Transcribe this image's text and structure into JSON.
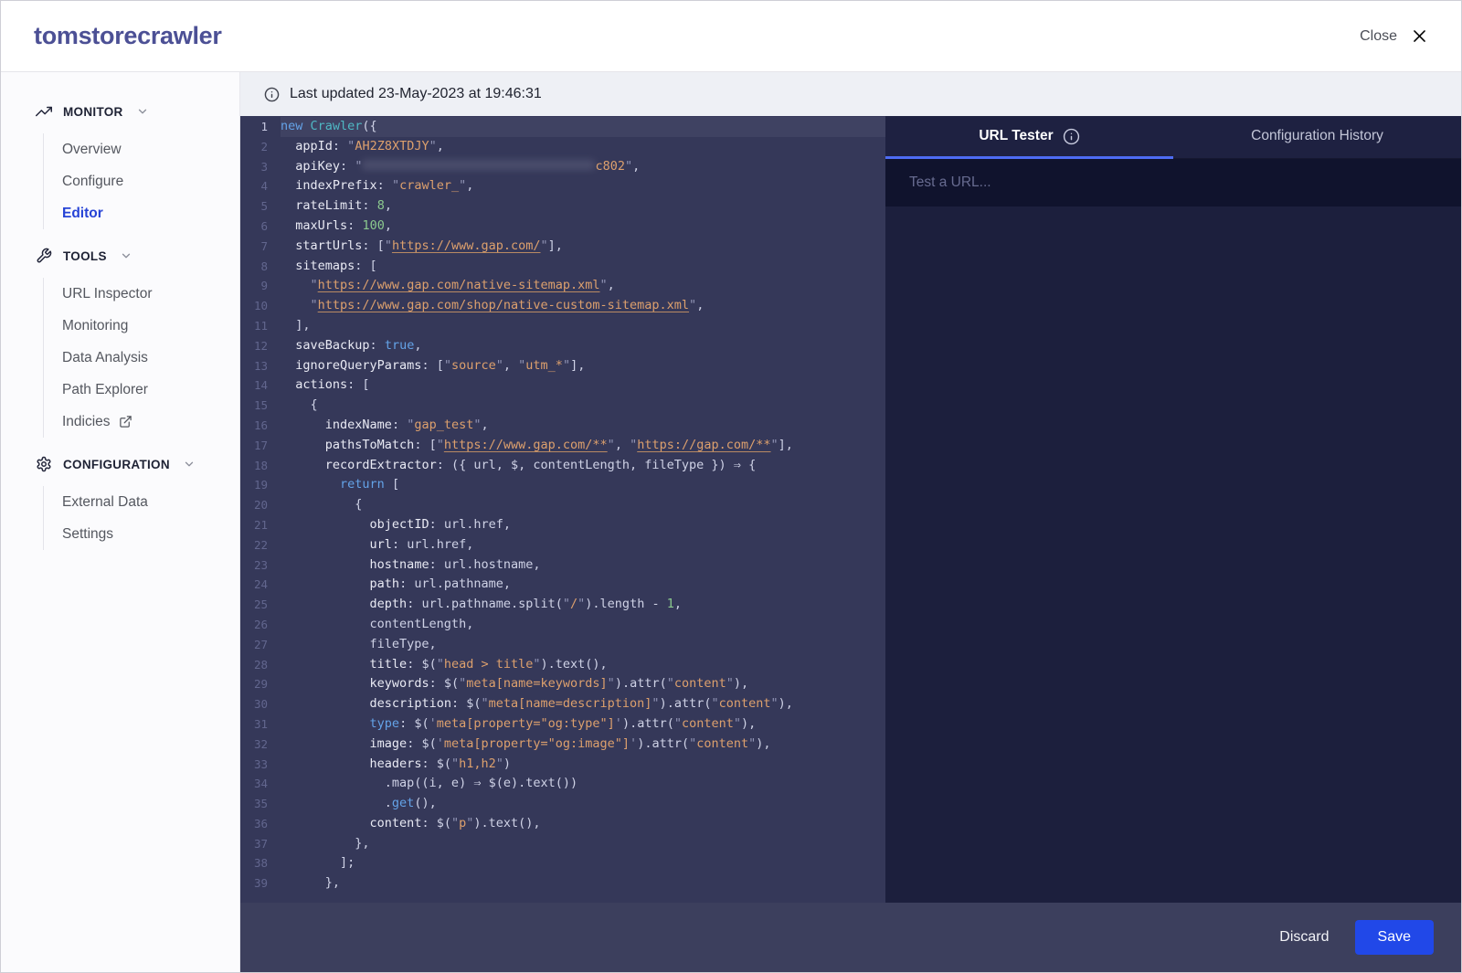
{
  "header": {
    "title": "tomstorecrawler",
    "close_label": "Close"
  },
  "sidebar": {
    "sections": [
      {
        "label": "MONITOR",
        "icon": "trending-up",
        "items": [
          {
            "label": "Overview"
          },
          {
            "label": "Configure"
          },
          {
            "label": "Editor",
            "active": true
          }
        ]
      },
      {
        "label": "TOOLS",
        "icon": "wrench",
        "items": [
          {
            "label": "URL Inspector"
          },
          {
            "label": "Monitoring"
          },
          {
            "label": "Data Analysis"
          },
          {
            "label": "Path Explorer"
          },
          {
            "label": "Indicies",
            "external": true
          }
        ]
      },
      {
        "label": "CONFIGURATION",
        "icon": "gear",
        "items": [
          {
            "label": "External Data"
          },
          {
            "label": "Settings"
          }
        ]
      }
    ]
  },
  "status_bar": {
    "text": "Last updated 23-May-2023 at 19:46:31"
  },
  "editor": {
    "lines": [
      {
        "hl": true,
        "t": [
          [
            "k",
            "new "
          ],
          [
            "t",
            "Crawler"
          ],
          [
            "p",
            "({"
          ]
        ]
      },
      {
        "t": [
          [
            "p",
            "  "
          ],
          [
            "key",
            "appId"
          ],
          [
            "p",
            ": "
          ],
          [
            "q",
            "\""
          ],
          [
            "s",
            "AH2Z8XTDJY"
          ],
          [
            "q",
            "\""
          ],
          [
            "p",
            ","
          ]
        ]
      },
      {
        "t": [
          [
            "p",
            "  "
          ],
          [
            "key",
            "apiKey"
          ],
          [
            "p",
            ": "
          ],
          [
            "q",
            "\""
          ],
          [
            "blur",
            ""
          ],
          [
            "s",
            "c802"
          ],
          [
            "q",
            "\""
          ],
          [
            "p",
            ","
          ]
        ]
      },
      {
        "t": [
          [
            "p",
            "  "
          ],
          [
            "key",
            "indexPrefix"
          ],
          [
            "p",
            ": "
          ],
          [
            "q",
            "\""
          ],
          [
            "s",
            "crawler_"
          ],
          [
            "q",
            "\""
          ],
          [
            "p",
            ","
          ]
        ]
      },
      {
        "t": [
          [
            "p",
            "  "
          ],
          [
            "key",
            "rateLimit"
          ],
          [
            "p",
            ": "
          ],
          [
            "n",
            "8"
          ],
          [
            "p",
            ","
          ]
        ]
      },
      {
        "t": [
          [
            "p",
            "  "
          ],
          [
            "key",
            "maxUrls"
          ],
          [
            "p",
            ": "
          ],
          [
            "n",
            "100"
          ],
          [
            "p",
            ","
          ]
        ]
      },
      {
        "t": [
          [
            "p",
            "  "
          ],
          [
            "key",
            "startUrls"
          ],
          [
            "p",
            ": ["
          ],
          [
            "q",
            "\""
          ],
          [
            "u",
            "https://www.gap.com/"
          ],
          [
            "q",
            "\""
          ],
          [
            "p",
            "],"
          ]
        ]
      },
      {
        "t": [
          [
            "p",
            "  "
          ],
          [
            "key",
            "sitemaps"
          ],
          [
            "p",
            ": ["
          ]
        ]
      },
      {
        "t": [
          [
            "p",
            "    "
          ],
          [
            "q",
            "\""
          ],
          [
            "u",
            "https://www.gap.com/native-sitemap.xml"
          ],
          [
            "q",
            "\""
          ],
          [
            "p",
            ","
          ]
        ]
      },
      {
        "t": [
          [
            "p",
            "    "
          ],
          [
            "q",
            "\""
          ],
          [
            "u",
            "https://www.gap.com/shop/native-custom-sitemap.xml"
          ],
          [
            "q",
            "\""
          ],
          [
            "p",
            ","
          ]
        ]
      },
      {
        "t": [
          [
            "p",
            "  ],"
          ]
        ]
      },
      {
        "t": [
          [
            "p",
            "  "
          ],
          [
            "key",
            "saveBackup"
          ],
          [
            "p",
            ": "
          ],
          [
            "k",
            "true"
          ],
          [
            "p",
            ","
          ]
        ]
      },
      {
        "t": [
          [
            "p",
            "  "
          ],
          [
            "key",
            "ignoreQueryParams"
          ],
          [
            "p",
            ": ["
          ],
          [
            "q",
            "\""
          ],
          [
            "s",
            "source"
          ],
          [
            "q",
            "\""
          ],
          [
            "p",
            ", "
          ],
          [
            "q",
            "\""
          ],
          [
            "s",
            "utm_*"
          ],
          [
            "q",
            "\""
          ],
          [
            "p",
            "],"
          ]
        ]
      },
      {
        "t": [
          [
            "p",
            "  "
          ],
          [
            "key",
            "actions"
          ],
          [
            "p",
            ": ["
          ]
        ]
      },
      {
        "t": [
          [
            "p",
            "    {"
          ]
        ]
      },
      {
        "t": [
          [
            "p",
            "      "
          ],
          [
            "key",
            "indexName"
          ],
          [
            "p",
            ": "
          ],
          [
            "q",
            "\""
          ],
          [
            "s",
            "gap_test"
          ],
          [
            "q",
            "\""
          ],
          [
            "p",
            ","
          ]
        ]
      },
      {
        "t": [
          [
            "p",
            "      "
          ],
          [
            "key",
            "pathsToMatch"
          ],
          [
            "p",
            ": ["
          ],
          [
            "q",
            "\""
          ],
          [
            "u",
            "https://www.gap.com/**"
          ],
          [
            "q",
            "\""
          ],
          [
            "p",
            ", "
          ],
          [
            "q",
            "\""
          ],
          [
            "u",
            "https://gap.com/**"
          ],
          [
            "q",
            "\""
          ],
          [
            "p",
            "],"
          ]
        ]
      },
      {
        "t": [
          [
            "p",
            "      "
          ],
          [
            "key",
            "recordExtractor"
          ],
          [
            "p",
            ": ({ url, $, contentLength, fileType }) ⇒ {"
          ]
        ]
      },
      {
        "t": [
          [
            "p",
            "        "
          ],
          [
            "k",
            "return"
          ],
          [
            "p",
            " ["
          ]
        ]
      },
      {
        "t": [
          [
            "p",
            "          {"
          ]
        ]
      },
      {
        "t": [
          [
            "p",
            "            "
          ],
          [
            "key",
            "objectID"
          ],
          [
            "p",
            ": url.href,"
          ]
        ]
      },
      {
        "t": [
          [
            "p",
            "            "
          ],
          [
            "key",
            "url"
          ],
          [
            "p",
            ": url.href,"
          ]
        ]
      },
      {
        "t": [
          [
            "p",
            "            "
          ],
          [
            "key",
            "hostname"
          ],
          [
            "p",
            ": url.hostname,"
          ]
        ]
      },
      {
        "t": [
          [
            "p",
            "            "
          ],
          [
            "key",
            "path"
          ],
          [
            "p",
            ": url.pathname,"
          ]
        ]
      },
      {
        "t": [
          [
            "p",
            "            "
          ],
          [
            "key",
            "depth"
          ],
          [
            "p",
            ": url.pathname.split("
          ],
          [
            "q",
            "\""
          ],
          [
            "s",
            "/"
          ],
          [
            "q",
            "\""
          ],
          [
            "p",
            ").length - "
          ],
          [
            "n",
            "1"
          ],
          [
            "p",
            ","
          ]
        ]
      },
      {
        "t": [
          [
            "p",
            "            contentLength,"
          ]
        ]
      },
      {
        "t": [
          [
            "p",
            "            fileType,"
          ]
        ]
      },
      {
        "t": [
          [
            "p",
            "            "
          ],
          [
            "key",
            "title"
          ],
          [
            "p",
            ": $("
          ],
          [
            "q",
            "\""
          ],
          [
            "s",
            "head > title"
          ],
          [
            "q",
            "\""
          ],
          [
            "p",
            ").text(),"
          ]
        ]
      },
      {
        "t": [
          [
            "p",
            "            "
          ],
          [
            "key",
            "keywords"
          ],
          [
            "p",
            ": $("
          ],
          [
            "q",
            "\""
          ],
          [
            "s",
            "meta[name=keywords]"
          ],
          [
            "q",
            "\""
          ],
          [
            "p",
            ").attr("
          ],
          [
            "q",
            "\""
          ],
          [
            "s",
            "content"
          ],
          [
            "q",
            "\""
          ],
          [
            "p",
            "),"
          ]
        ]
      },
      {
        "t": [
          [
            "p",
            "            "
          ],
          [
            "key",
            "description"
          ],
          [
            "p",
            ": $("
          ],
          [
            "q",
            "\""
          ],
          [
            "s",
            "meta[name=description]"
          ],
          [
            "q",
            "\""
          ],
          [
            "p",
            ").attr("
          ],
          [
            "q",
            "\""
          ],
          [
            "s",
            "content"
          ],
          [
            "q",
            "\""
          ],
          [
            "p",
            "),"
          ]
        ]
      },
      {
        "t": [
          [
            "p",
            "            "
          ],
          [
            "k",
            "type"
          ],
          [
            "p",
            ": $("
          ],
          [
            "q",
            "'"
          ],
          [
            "s",
            "meta[property=\"og:type\"]"
          ],
          [
            "q",
            "'"
          ],
          [
            "p",
            ").attr("
          ],
          [
            "q",
            "\""
          ],
          [
            "s",
            "content"
          ],
          [
            "q",
            "\""
          ],
          [
            "p",
            "),"
          ]
        ]
      },
      {
        "t": [
          [
            "p",
            "            "
          ],
          [
            "key",
            "image"
          ],
          [
            "p",
            ": $("
          ],
          [
            "q",
            "'"
          ],
          [
            "s",
            "meta[property=\"og:image\"]"
          ],
          [
            "q",
            "'"
          ],
          [
            "p",
            ").attr("
          ],
          [
            "q",
            "\""
          ],
          [
            "s",
            "content"
          ],
          [
            "q",
            "\""
          ],
          [
            "p",
            "),"
          ]
        ]
      },
      {
        "t": [
          [
            "p",
            "            "
          ],
          [
            "key",
            "headers"
          ],
          [
            "p",
            ": $("
          ],
          [
            "q",
            "\""
          ],
          [
            "s",
            "h1,h2"
          ],
          [
            "q",
            "\""
          ],
          [
            "p",
            ")"
          ]
        ]
      },
      {
        "t": [
          [
            "p",
            "              .map((i, e) ⇒ $(e).text())"
          ]
        ]
      },
      {
        "t": [
          [
            "p",
            "              ."
          ],
          [
            "k",
            "get"
          ],
          [
            "p",
            "(),"
          ]
        ]
      },
      {
        "t": [
          [
            "p",
            "            "
          ],
          [
            "key",
            "content"
          ],
          [
            "p",
            ": $("
          ],
          [
            "q",
            "\""
          ],
          [
            "s",
            "p"
          ],
          [
            "q",
            "\""
          ],
          [
            "p",
            ").text(),"
          ]
        ]
      },
      {
        "t": [
          [
            "p",
            "          },"
          ]
        ]
      },
      {
        "t": [
          [
            "p",
            "        ];"
          ]
        ]
      },
      {
        "t": [
          [
            "p",
            "      },"
          ]
        ]
      }
    ]
  },
  "url_tester": {
    "tab_label": "URL Tester",
    "history_tab_label": "Configuration History",
    "input_placeholder": "Test a URL..."
  },
  "footer": {
    "discard_label": "Discard",
    "save_label": "Save"
  },
  "colors": {
    "brand_indigo": "#4c5095",
    "active_nav_blue": "#2643d6",
    "tab_underline_blue": "#4e6cf3",
    "save_button_blue": "#2148e8",
    "editor_background": "#353859",
    "panel_background": "#1c1f3d",
    "string_orange": "#dda06d",
    "keyword_blue": "#64a3e8",
    "number_green": "#8bc98e"
  }
}
